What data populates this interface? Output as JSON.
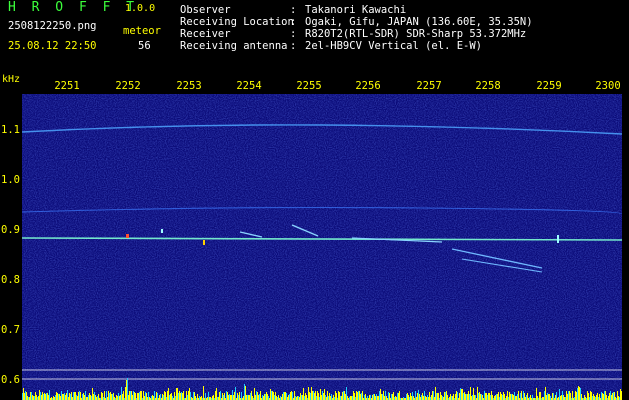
{
  "app": {
    "title": "H R O F F T",
    "version": "1.0.0"
  },
  "file": {
    "name": "2508122250.png",
    "datetime": "25.08.12 22:50"
  },
  "meteor": {
    "label": "meteor",
    "count": "56"
  },
  "info": [
    {
      "label": "Observer",
      "value": "Takanori Kawachi"
    },
    {
      "label": "Receiving Location",
      "value": "Ogaki, Gifu, JAPAN (136.60E, 35.35N)"
    },
    {
      "label": "Receiver",
      "value": "R820T2(RTL-SDR) SDR-Sharp 53.372MHz"
    },
    {
      "label": "Receiving antenna",
      "value": "2el-HB9CV Vertical (el. E-W)"
    }
  ],
  "axis": {
    "unit": "kHz",
    "x_ticks": [
      "2251",
      "2252",
      "2253",
      "2254",
      "2255",
      "2256",
      "2257",
      "2258",
      "2259",
      "2300"
    ],
    "y_ticks": [
      "1.1",
      "1.0",
      "0.9",
      "0.8",
      "0.7",
      "0.6"
    ]
  },
  "colors": {
    "background": "#000000",
    "spectrogram_bg": "#0a0a78",
    "signal": "#4da6ff",
    "carrier": "#7fffd4",
    "bars": "#ffff00",
    "labels": "#ffff00",
    "title": "#3cff3c"
  }
}
